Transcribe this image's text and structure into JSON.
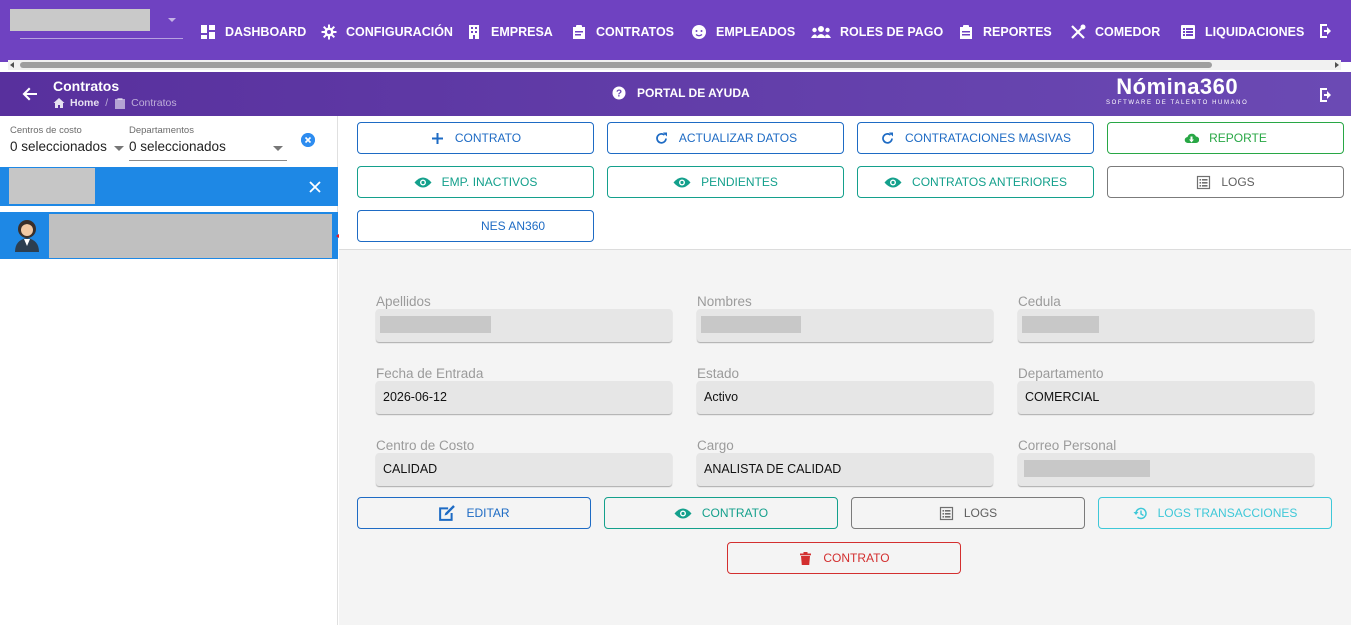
{
  "topnav": {
    "items": [
      {
        "label": "DASHBOARD",
        "icon": "dashboard-icon"
      },
      {
        "label": "CONFIGURACIÓN",
        "icon": "gear-icon"
      },
      {
        "label": "EMPRESA",
        "icon": "building-icon"
      },
      {
        "label": "CONTRATOS",
        "icon": "clipboard-icon"
      },
      {
        "label": "EMPLEADOS",
        "icon": "face-icon"
      },
      {
        "label": "ROLES DE PAGO",
        "icon": "users-icon"
      },
      {
        "label": "REPORTES",
        "icon": "report-icon"
      },
      {
        "label": "COMEDOR",
        "icon": "utensils-icon"
      },
      {
        "label": "LIQUIDACIONES",
        "icon": "list-icon"
      }
    ]
  },
  "subheader": {
    "title": "Contratos",
    "breadcrumb_home": "Home",
    "breadcrumb_sep": "/",
    "breadcrumb_current": "Contratos",
    "help_label": "PORTAL DE AYUDA",
    "brand_name": "Nómina360",
    "brand_tagline": "SOFTWARE DE TALENTO HUMANO"
  },
  "sidebar": {
    "cost_center_label": "Centros de costo",
    "cost_center_value": "0 seleccionados",
    "department_label": "Departamentos",
    "department_value": "0 seleccionados"
  },
  "actions": {
    "contrato": "CONTRATO",
    "actualizar": "ACTUALIZAR DATOS",
    "masivas": "CONTRATACIONES MASIVAS",
    "reporte": "REPORTE",
    "inactivos": "EMP. INACTIVOS",
    "pendientes": "PENDIENTES",
    "anteriores": "CONTRATOS ANTERIORES",
    "logs": "LOGS",
    "an360": "NES AN360"
  },
  "detail": {
    "apellidos_label": "Apellidos",
    "nombres_label": "Nombres",
    "cedula_label": "Cedula",
    "fecha_label": "Fecha de Entrada",
    "fecha_value": "2026-06-12",
    "estado_label": "Estado",
    "estado_value": "Activo",
    "departamento_label": "Departamento",
    "departamento_value": "COMERCIAL",
    "centro_label": "Centro de Costo",
    "centro_value": "CALIDAD",
    "cargo_label": "Cargo",
    "cargo_value": "ANALISTA DE CALIDAD",
    "correo_label": "Correo Personal"
  },
  "bottom_actions": {
    "editar": "EDITAR",
    "contrato": "CONTRATO",
    "logs": "LOGS",
    "logs_transacciones": "LOGS TRANSACCIONES",
    "delete_contrato": "CONTRATO"
  },
  "colors": {
    "header": "#6f42c1",
    "selection": "#1e88e5",
    "primary": "#1e6bc4",
    "teal": "#14a08c",
    "green": "#28a745",
    "danger": "#d32f2f",
    "pointer_arrow": "#ed1c24"
  }
}
